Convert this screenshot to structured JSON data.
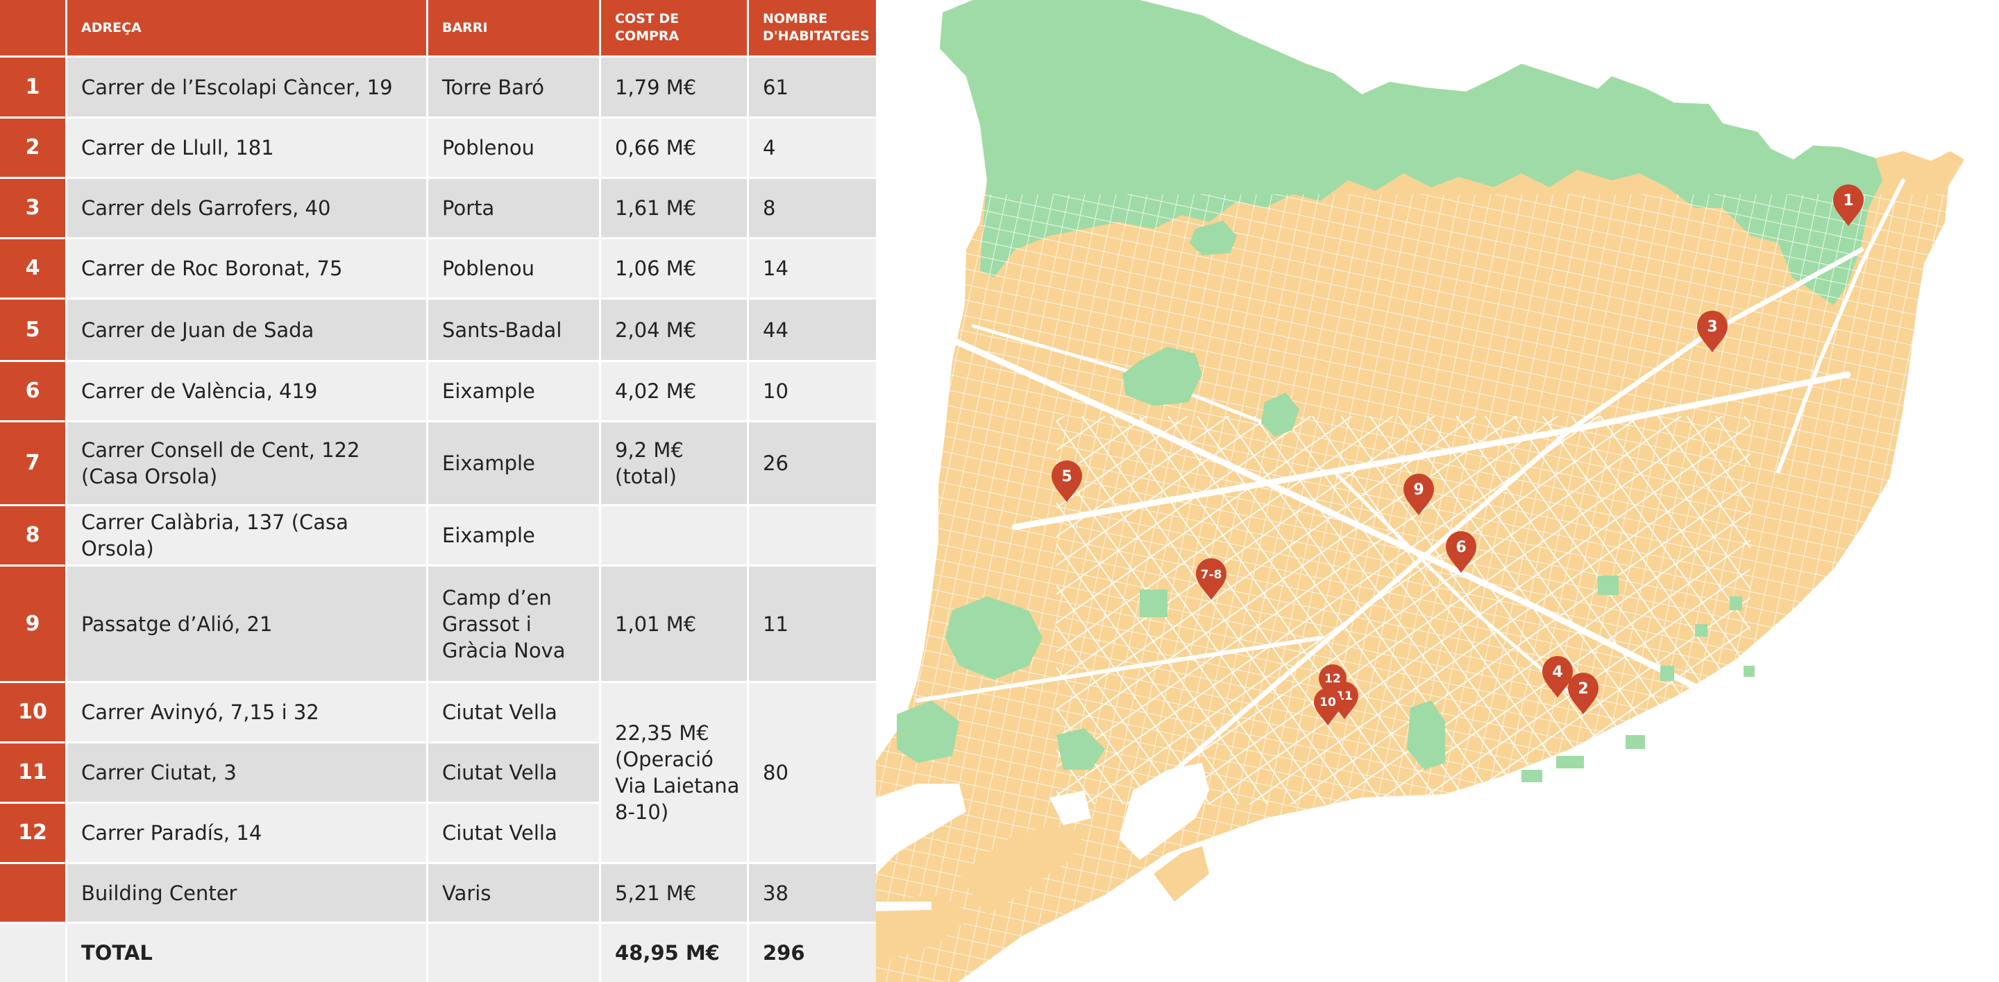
{
  "colors": {
    "header_bg": "#cf4a2b",
    "number_bg": "#cf4a2b",
    "row_dark": "#dedede",
    "row_light": "#efefef",
    "map_land": "#f8d394",
    "map_green": "#9fdba6",
    "map_streets": "#ffffff",
    "marker": "#c8442a"
  },
  "table": {
    "headers": {
      "address": "ADREÇA",
      "district": "BARRI",
      "cost": "COST DE COMPRA",
      "homes": "NOMBRE D'HABITATGES"
    },
    "rows": [
      {
        "num": "1",
        "address": "Carrer de l’Escolapi Càncer, 19",
        "district": "Torre Baró",
        "cost": "1,79 M€",
        "homes": "61"
      },
      {
        "num": "2",
        "address": "Carrer de Llull, 181",
        "district": "Poblenou",
        "cost": "0,66 M€",
        "homes": "4"
      },
      {
        "num": "3",
        "address": "Carrer dels Garrofers, 40",
        "district": "Porta",
        "cost": "1,61 M€",
        "homes": "8"
      },
      {
        "num": "4",
        "address": "Carrer de Roc Boronat, 75",
        "district": "Poblenou",
        "cost": "1,06 M€",
        "homes": "14"
      },
      {
        "num": "5",
        "address": "Carrer de Juan de Sada",
        "district": "Sants-Badal",
        "cost": "2,04 M€",
        "homes": "44"
      },
      {
        "num": "6",
        "address": "Carrer de València, 419",
        "district": "Eixample",
        "cost": "4,02 M€",
        "homes": "10"
      },
      {
        "num": "7",
        "address": "Carrer Consell de Cent, 122\n(Casa Orsola)",
        "district": "Eixample",
        "cost": "9,2 M€\n(total)",
        "homes": "26"
      },
      {
        "num": "8",
        "address": "Carrer Calàbria, 137 (Casa Orsola)",
        "district": "Eixample",
        "cost": "",
        "homes": ""
      },
      {
        "num": "9",
        "address": "Passatge d’Alió, 21",
        "district": "Camp d’en\nGrassot i\nGràcia Nova",
        "cost": "1,01 M€",
        "homes": "11"
      },
      {
        "num": "10",
        "address": "Carrer Avinyó, 7,15 i 32",
        "district": "Ciutat Vella",
        "cost": "",
        "homes": ""
      },
      {
        "num": "11",
        "address": "Carrer Ciutat, 3",
        "district": "Ciutat Vella",
        "cost": "",
        "homes": ""
      },
      {
        "num": "12",
        "address": "Carrer Paradís, 14",
        "district": "Ciutat Vella",
        "cost": "",
        "homes": ""
      },
      {
        "num": "",
        "address": "Building Center",
        "district": "Varis",
        "cost": "5,21 M€",
        "homes": "38"
      }
    ],
    "merged_group": {
      "cost": "22,35 M€\n(Operació\nVia Laietana\n8-10)",
      "homes": "80"
    },
    "total": {
      "label": "TOTAL",
      "cost": "48,95 M€",
      "homes": "296"
    }
  },
  "map": {
    "markers": [
      {
        "label": "1"
      },
      {
        "label": "2"
      },
      {
        "label": "3"
      },
      {
        "label": "4"
      },
      {
        "label": "5"
      },
      {
        "label": "6"
      },
      {
        "label": "7-8"
      },
      {
        "label": "9"
      },
      {
        "label": "10"
      },
      {
        "label": "11"
      },
      {
        "label": "12"
      }
    ]
  }
}
